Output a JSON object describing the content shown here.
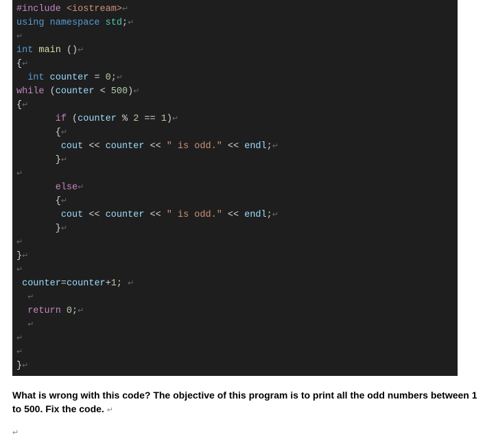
{
  "code": {
    "lines": [
      [
        {
          "cls": "preproc",
          "t": "#include"
        },
        {
          "cls": "",
          "t": " "
        },
        {
          "cls": "include-target",
          "t": "<iostream>"
        },
        {
          "cls": "eol",
          "t": "↵"
        }
      ],
      [
        {
          "cls": "keyword",
          "t": "using"
        },
        {
          "cls": "",
          "t": " "
        },
        {
          "cls": "keyword",
          "t": "namespace"
        },
        {
          "cls": "",
          "t": " "
        },
        {
          "cls": "namespace",
          "t": "std"
        },
        {
          "cls": "",
          "t": ";"
        },
        {
          "cls": "eol",
          "t": "↵"
        }
      ],
      [
        {
          "cls": "eol",
          "t": "↵"
        }
      ],
      [
        {
          "cls": "type",
          "t": "int"
        },
        {
          "cls": "",
          "t": " "
        },
        {
          "cls": "func",
          "t": "main"
        },
        {
          "cls": "",
          "t": " "
        },
        {
          "cls": "paren",
          "t": "()"
        },
        {
          "cls": "eol",
          "t": "↵"
        }
      ],
      [
        {
          "cls": "brace",
          "t": "{"
        },
        {
          "cls": "eol",
          "t": "↵"
        }
      ],
      [
        {
          "cls": "",
          "t": "  "
        },
        {
          "cls": "type",
          "t": "int"
        },
        {
          "cls": "",
          "t": " "
        },
        {
          "cls": "identifier",
          "t": "counter"
        },
        {
          "cls": "",
          "t": " "
        },
        {
          "cls": "op",
          "t": "="
        },
        {
          "cls": "",
          "t": " "
        },
        {
          "cls": "number",
          "t": "0"
        },
        {
          "cls": "",
          "t": ";"
        },
        {
          "cls": "eol",
          "t": "↵"
        }
      ],
      [
        {
          "cls": "control",
          "t": "while"
        },
        {
          "cls": "",
          "t": " "
        },
        {
          "cls": "paren",
          "t": "("
        },
        {
          "cls": "identifier",
          "t": "counter"
        },
        {
          "cls": "",
          "t": " "
        },
        {
          "cls": "op",
          "t": "<"
        },
        {
          "cls": "",
          "t": " "
        },
        {
          "cls": "number",
          "t": "500"
        },
        {
          "cls": "paren",
          "t": ")"
        },
        {
          "cls": "eol",
          "t": "↵"
        }
      ],
      [
        {
          "cls": "brace",
          "t": "{"
        },
        {
          "cls": "eol",
          "t": "↵"
        }
      ],
      [
        {
          "cls": "",
          "t": "       "
        },
        {
          "cls": "control",
          "t": "if"
        },
        {
          "cls": "",
          "t": " "
        },
        {
          "cls": "paren",
          "t": "("
        },
        {
          "cls": "identifier",
          "t": "counter"
        },
        {
          "cls": "",
          "t": " "
        },
        {
          "cls": "op",
          "t": "%"
        },
        {
          "cls": "",
          "t": " "
        },
        {
          "cls": "number",
          "t": "2"
        },
        {
          "cls": "",
          "t": " "
        },
        {
          "cls": "op",
          "t": "=="
        },
        {
          "cls": "",
          "t": " "
        },
        {
          "cls": "number",
          "t": "1"
        },
        {
          "cls": "paren",
          "t": ")"
        },
        {
          "cls": "eol",
          "t": "↵"
        }
      ],
      [
        {
          "cls": "",
          "t": "       "
        },
        {
          "cls": "brace",
          "t": "{"
        },
        {
          "cls": "eol",
          "t": "↵"
        }
      ],
      [
        {
          "cls": "",
          "t": "        "
        },
        {
          "cls": "identifier",
          "t": "cout"
        },
        {
          "cls": "",
          "t": " "
        },
        {
          "cls": "op",
          "t": "<<"
        },
        {
          "cls": "",
          "t": " "
        },
        {
          "cls": "identifier",
          "t": "counter"
        },
        {
          "cls": "",
          "t": " "
        },
        {
          "cls": "op",
          "t": "<<"
        },
        {
          "cls": "",
          "t": " "
        },
        {
          "cls": "string",
          "t": "\" is odd.\""
        },
        {
          "cls": "",
          "t": " "
        },
        {
          "cls": "op",
          "t": "<<"
        },
        {
          "cls": "",
          "t": " "
        },
        {
          "cls": "identifier",
          "t": "endl"
        },
        {
          "cls": "",
          "t": ";"
        },
        {
          "cls": "eol",
          "t": "↵"
        }
      ],
      [
        {
          "cls": "",
          "t": "       "
        },
        {
          "cls": "brace",
          "t": "}"
        },
        {
          "cls": "eol",
          "t": "↵"
        }
      ],
      [
        {
          "cls": "eol",
          "t": "↵"
        }
      ],
      [
        {
          "cls": "",
          "t": "       "
        },
        {
          "cls": "control",
          "t": "else"
        },
        {
          "cls": "eol",
          "t": "↵"
        }
      ],
      [
        {
          "cls": "",
          "t": "       "
        },
        {
          "cls": "brace",
          "t": "{"
        },
        {
          "cls": "eol",
          "t": "↵"
        }
      ],
      [
        {
          "cls": "",
          "t": "        "
        },
        {
          "cls": "identifier",
          "t": "cout"
        },
        {
          "cls": "",
          "t": " "
        },
        {
          "cls": "op",
          "t": "<<"
        },
        {
          "cls": "",
          "t": " "
        },
        {
          "cls": "identifier",
          "t": "counter"
        },
        {
          "cls": "",
          "t": " "
        },
        {
          "cls": "op",
          "t": "<<"
        },
        {
          "cls": "",
          "t": " "
        },
        {
          "cls": "string",
          "t": "\" is odd.\""
        },
        {
          "cls": "",
          "t": " "
        },
        {
          "cls": "op",
          "t": "<<"
        },
        {
          "cls": "",
          "t": " "
        },
        {
          "cls": "identifier",
          "t": "endl"
        },
        {
          "cls": "",
          "t": ";"
        },
        {
          "cls": "eol",
          "t": "↵"
        }
      ],
      [
        {
          "cls": "",
          "t": "       "
        },
        {
          "cls": "brace",
          "t": "}"
        },
        {
          "cls": "eol",
          "t": "↵"
        }
      ],
      [
        {
          "cls": "eol",
          "t": "↵"
        }
      ],
      [
        {
          "cls": "brace",
          "t": "}"
        },
        {
          "cls": "eol",
          "t": "↵"
        }
      ],
      [
        {
          "cls": "eol",
          "t": "↵"
        }
      ],
      [
        {
          "cls": "",
          "t": " "
        },
        {
          "cls": "identifier",
          "t": "counter"
        },
        {
          "cls": "op",
          "t": "="
        },
        {
          "cls": "identifier",
          "t": "counter"
        },
        {
          "cls": "op",
          "t": "+"
        },
        {
          "cls": "number",
          "t": "1"
        },
        {
          "cls": "",
          "t": "; "
        },
        {
          "cls": "eol",
          "t": "↵"
        }
      ],
      [
        {
          "cls": "",
          "t": "  "
        },
        {
          "cls": "eol",
          "t": "↵"
        }
      ],
      [
        {
          "cls": "",
          "t": "  "
        },
        {
          "cls": "control",
          "t": "return"
        },
        {
          "cls": "",
          "t": " "
        },
        {
          "cls": "number",
          "t": "0"
        },
        {
          "cls": "",
          "t": ";"
        },
        {
          "cls": "eol",
          "t": "↵"
        }
      ],
      [
        {
          "cls": "",
          "t": "  "
        },
        {
          "cls": "eol",
          "t": "↵"
        }
      ],
      [
        {
          "cls": "eol",
          "t": "↵"
        }
      ],
      [
        {
          "cls": "eol",
          "t": "↵"
        }
      ],
      [
        {
          "cls": "brace",
          "t": "}"
        },
        {
          "cls": "eol",
          "t": "↵"
        }
      ]
    ]
  },
  "question": {
    "text": "What is wrong with this code? The objective of this program is to print all the odd numbers between 1 to 500. Fix the code. ",
    "arrow": "↵"
  },
  "trailing_arrow": "↵"
}
